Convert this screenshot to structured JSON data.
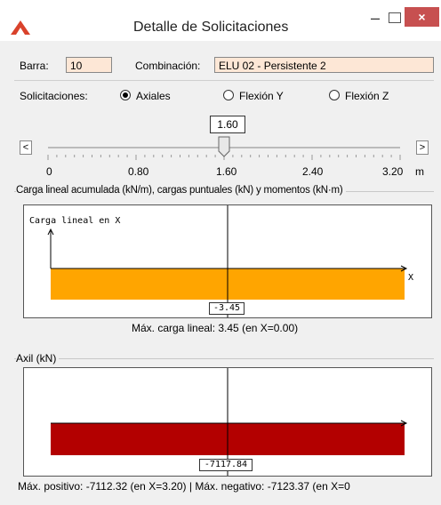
{
  "window": {
    "title": "Detalle de Solicitaciones",
    "close_glyph": "×",
    "min_glyph": "–"
  },
  "form": {
    "barra_label": "Barra:",
    "barra_value": "10",
    "combinacion_label": "Combinación:",
    "combinacion_value": "ELU 02 - Persistente 2",
    "solicitaciones_label": "Solicitaciones:",
    "options": [
      "Axiales",
      "Flexión Y",
      "Flexión Z"
    ],
    "selected_option": "Axiales"
  },
  "slider": {
    "value_label": "1.60",
    "left_arrow": "<",
    "right_arrow": ">",
    "ticks": [
      "0",
      "0.80",
      "1.60",
      "2.40",
      "3.20"
    ],
    "unit": "m",
    "position_fraction": 0.5
  },
  "carga": {
    "group_title": "Carga lineal acumulada (kN/m), cargas puntuales (kN) y momentos (kN·m)",
    "axis_label": "Carga lineal en X",
    "x_label": "X",
    "value_label": "-3.45",
    "summary": "Máx. carga lineal: 3.45 (en X=0.00)",
    "color": "#ffa500"
  },
  "axil": {
    "group_title": "Axil (kN)",
    "value_label": "-7117.84",
    "summary": "Máx. positivo: -7112.32 (en X=3.20)  |  Máx. negativo: -7123.37 (en X=0",
    "color": "#b30000"
  }
}
